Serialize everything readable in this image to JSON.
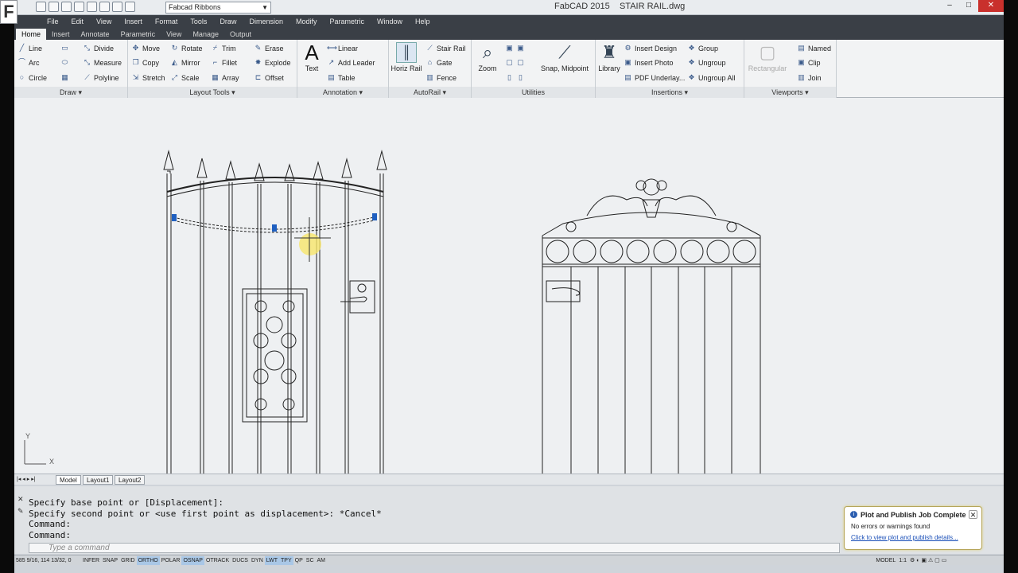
{
  "app": {
    "title": "FabCAD 2015",
    "document": "STAIR RAIL.dwg",
    "workspace": "Fabcad Ribbons",
    "logo_letter": "F"
  },
  "menu": [
    "File",
    "Edit",
    "View",
    "Insert",
    "Format",
    "Tools",
    "Draw",
    "Dimension",
    "Modify",
    "Parametric",
    "Window",
    "Help"
  ],
  "tabs": [
    "Home",
    "Insert",
    "Annotate",
    "Parametric",
    "View",
    "Manage",
    "Output"
  ],
  "ribbon": {
    "draw": {
      "title": "Draw",
      "line": "Line",
      "arc": "Arc",
      "circle": "Circle",
      "divide": "Divide",
      "measure": "Measure",
      "polyline": "Polyline"
    },
    "layout": {
      "title": "Layout Tools",
      "move": "Move",
      "copy": "Copy",
      "stretch": "Stretch",
      "rotate": "Rotate",
      "mirror": "Mirror",
      "scale": "Scale",
      "trim": "Trim",
      "fillet": "Fillet",
      "array": "Array",
      "erase": "Erase",
      "explode": "Explode",
      "offset": "Offset"
    },
    "annotation": {
      "title": "Annotation",
      "text": "Text",
      "linear": "Linear",
      "add_leader": "Add Leader",
      "table": "Table"
    },
    "autorail": {
      "title": "AutoRail",
      "horiz_rail": "Horiz Rail",
      "stair_rail": "Stair Rail",
      "gate": "Gate",
      "fence": "Fence"
    },
    "utilities": {
      "title": "Utilities",
      "zoom": "Zoom",
      "snap": "Snap, Midpoint"
    },
    "insertions": {
      "title": "Insertions",
      "library": "Library",
      "insert_design": "Insert Design",
      "insert_photo": "Insert Photo",
      "pdf_underlay": "PDF Underlay...",
      "group": "Group",
      "ungroup": "Ungroup",
      "ungroup_all": "Ungroup All"
    },
    "viewports": {
      "title": "Viewports",
      "rectangular": "Rectangular",
      "named": "Named",
      "clip": "Clip",
      "join": "Join"
    }
  },
  "layout_tabs": [
    "Model",
    "Layout1",
    "Layout2"
  ],
  "ucs": {
    "x": "X",
    "y": "Y"
  },
  "command": {
    "history": [
      "Specify base point or [Displacement]:",
      "Specify second point or <use first point as displacement>: *Cancel*",
      "Command:",
      "Command:"
    ],
    "placeholder": "Type a command"
  },
  "status": {
    "coords": "585 9/16, 114 13/32, 0",
    "toggles": [
      "INFER",
      "SNAP",
      "GRID",
      "ORTHO",
      "POLAR",
      "OSNAP",
      "OTRACK",
      "DUCS",
      "DYN",
      "LWT",
      "TPY",
      "QP",
      "SC",
      "AM"
    ],
    "active_toggles": [
      "ORTHO",
      "OSNAP",
      "LWT",
      "TPY"
    ],
    "model": "MODEL",
    "scale": "1:1"
  },
  "notification": {
    "title": "Plot and Publish Job Complete",
    "message": "No errors or warnings found",
    "link": "Click to view plot and publish details..."
  }
}
